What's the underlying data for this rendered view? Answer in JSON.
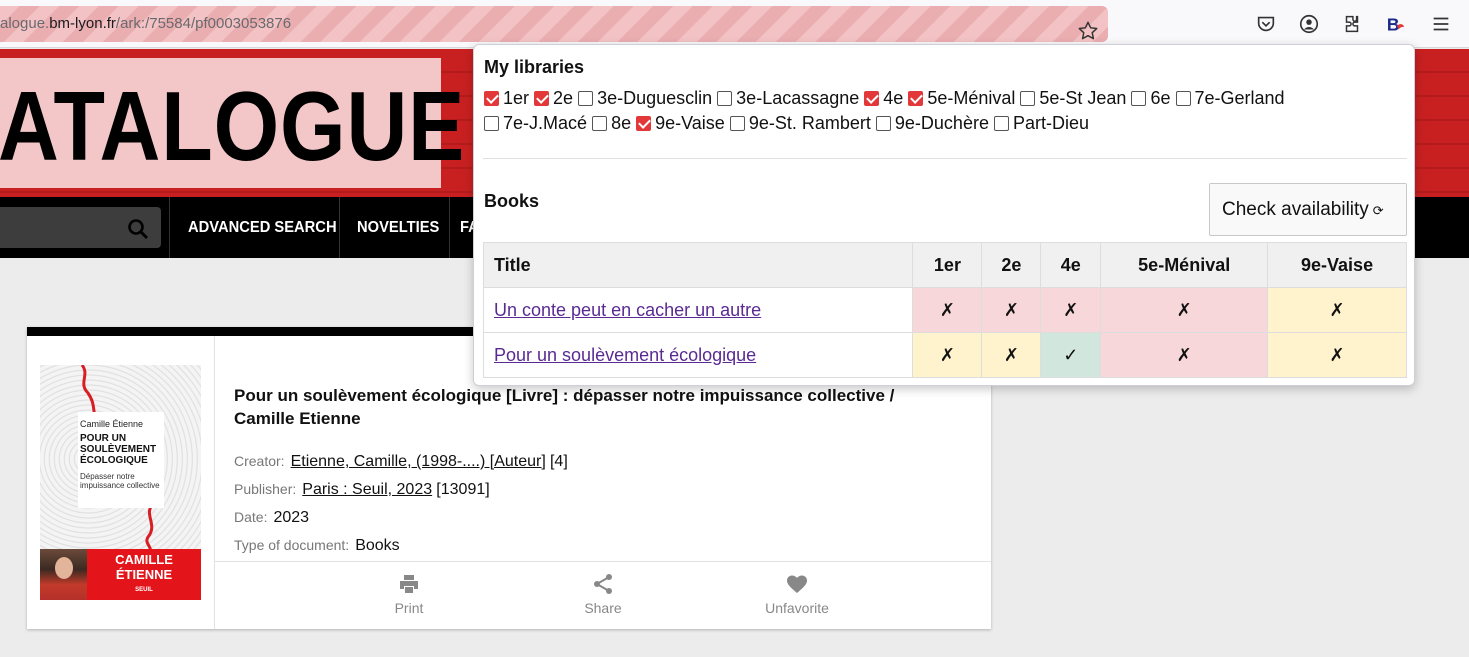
{
  "browser": {
    "url_prefix": "alogue.",
    "url_domain": "bm-lyon.fr",
    "url_path": "/ark:/75584/pf0003053876",
    "icons": [
      "bookmark-star-icon",
      "pocket-icon",
      "account-icon",
      "extensions-icon",
      "extension-b-icon",
      "menu-icon"
    ]
  },
  "site": {
    "banner_text": "ATALOGUE",
    "nav": [
      "ADVANCED SEARCH",
      "NOVELTIES",
      "FA"
    ]
  },
  "record": {
    "title": "Pour un soulèvement écologique [Livre] : dépasser notre impuissance collective / Camille Etienne",
    "creator_label": "Creator:",
    "creator_value": "Etienne, Camille, (1998-....) [Auteur]",
    "creator_count": "[4]",
    "publisher_label": "Publisher:",
    "publisher_value": "Paris : Seuil, 2023",
    "publisher_count": "[13091]",
    "date_label": "Date:",
    "date_value": "2023",
    "type_label": "Type of document:",
    "type_value": "Books",
    "cover": {
      "author": "Camille Étienne",
      "title": "POUR UN SOULÈVEMENT ÉCOLOGIQUE",
      "subtitle": "Dépasser notre impuissance collective",
      "name": "CAMILLE ÉTIENNE",
      "publisher": "SEUIL"
    },
    "actions": [
      "Print",
      "Share",
      "Unfavorite"
    ]
  },
  "popup": {
    "libraries_heading": "My libraries",
    "libraries": [
      {
        "name": "1er",
        "checked": true
      },
      {
        "name": "2e",
        "checked": true
      },
      {
        "name": "3e-Duguesclin",
        "checked": false
      },
      {
        "name": "3e-Lacassagne",
        "checked": false
      },
      {
        "name": "4e",
        "checked": true
      },
      {
        "name": "5e-Ménival",
        "checked": true
      },
      {
        "name": "5e-St Jean",
        "checked": false
      },
      {
        "name": "6e",
        "checked": false
      },
      {
        "name": "7e-Gerland",
        "checked": false
      },
      {
        "name": "7e-J.Macé",
        "checked": false
      },
      {
        "name": "8e",
        "checked": false
      },
      {
        "name": "9e-Vaise",
        "checked": true
      },
      {
        "name": "9e-St. Rambert",
        "checked": false
      },
      {
        "name": "9e-Duchère",
        "checked": false
      },
      {
        "name": "Part-Dieu",
        "checked": false
      }
    ],
    "books_heading": "Books",
    "check_button": "Check availability",
    "refresh_glyph": "⟳",
    "columns": [
      "Title",
      "1er",
      "2e",
      "4e",
      "5e-Ménival",
      "9e-Vaise"
    ],
    "rows": [
      {
        "title": "Un conte peut en cacher un autre",
        "cells": [
          {
            "mark": "✗",
            "status": "red"
          },
          {
            "mark": "✗",
            "status": "red"
          },
          {
            "mark": "✗",
            "status": "red"
          },
          {
            "mark": "✗",
            "status": "red"
          },
          {
            "mark": "✗",
            "status": "yellow"
          }
        ]
      },
      {
        "title": "Pour un soulèvement écologique",
        "cells": [
          {
            "mark": "✗",
            "status": "yellow"
          },
          {
            "mark": "✗",
            "status": "yellow"
          },
          {
            "mark": "✓",
            "status": "green"
          },
          {
            "mark": "✗",
            "status": "red"
          },
          {
            "mark": "✗",
            "status": "yellow"
          }
        ]
      }
    ],
    "colors": {
      "red": "#f8d7da",
      "yellow": "#fff3cd",
      "green": "#d1e7dd",
      "checkbox": "#e2383a"
    }
  }
}
